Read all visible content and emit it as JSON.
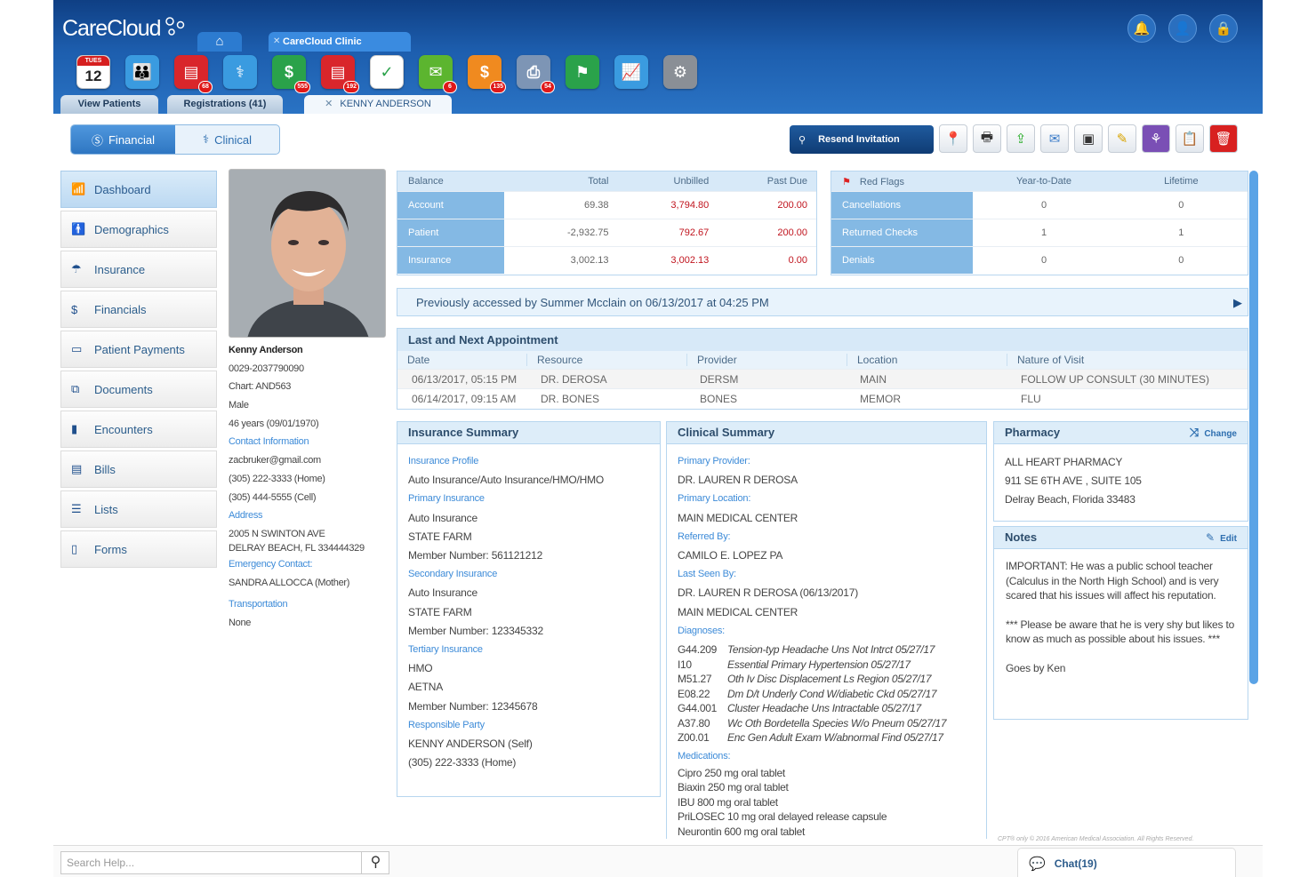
{
  "brand": {
    "logo": "CareCloud"
  },
  "tabs": {
    "clinic": "CareCloud Clinic",
    "view_patients": "View Patients",
    "registrations": "Registrations (41)",
    "patient": "KENNY ANDERSON"
  },
  "calendar": {
    "day": "TUES",
    "date": "12"
  },
  "apps": [
    {
      "name": "calendar-app-icon",
      "color": "#ffffff"
    },
    {
      "name": "patients-app-icon",
      "color": "#3a9be0"
    },
    {
      "name": "records-app-icon",
      "color": "#d9262b",
      "badge": "68"
    },
    {
      "name": "clinical-app-icon",
      "color": "#3a9be0"
    },
    {
      "name": "billing-app-icon",
      "color": "#2aa24a",
      "badge": "555"
    },
    {
      "name": "documents-app-icon",
      "color": "#d9262b",
      "badge": "192"
    },
    {
      "name": "tasks-app-icon",
      "color": "#ffffff"
    },
    {
      "name": "messages-app-icon",
      "color": "#5cb52f",
      "badge": "6"
    },
    {
      "name": "collections-app-icon",
      "color": "#f08a1f",
      "badge": "135"
    },
    {
      "name": "fax-app-icon",
      "color": "#7d95b5",
      "badge": "54"
    },
    {
      "name": "campaign-app-icon",
      "color": "#2aa24a"
    },
    {
      "name": "analytics-app-icon",
      "color": "#3a9be0"
    },
    {
      "name": "settings-app-icon",
      "color": "#8a8f96"
    }
  ],
  "toggle": {
    "financial": "Financial",
    "clinical": "Clinical"
  },
  "resend": "Resend Invitation",
  "nav": [
    "Dashboard",
    "Demographics",
    "Insurance",
    "Financials",
    "Patient Payments",
    "Documents",
    "Encounters",
    "Bills",
    "Lists",
    "Forms"
  ],
  "patient": {
    "name": "Kenny Anderson",
    "id": "0029-2037790090",
    "chart": "Chart: AND563",
    "sex": "Male",
    "age": "46 years (09/01/1970)",
    "contact_h": "Contact Information",
    "email": "zacbruker@gmail.com",
    "home": "(305) 222-3333 (Home)",
    "cell": "(305) 444-5555 (Cell)",
    "address_h": "Address",
    "addr1": "2005 N SWINTON AVE",
    "addr2": "DELRAY BEACH, FL 334444329",
    "emergency_h": "Emergency Contact:",
    "emergency": "SANDRA ALLOCCA (Mother)",
    "transport_h": "Transportation",
    "transport": "None"
  },
  "balance": {
    "headers": [
      "Balance",
      "Total",
      "Unbilled",
      "Past Due"
    ],
    "rows": [
      {
        "label": "Account",
        "total": "69.38",
        "unbilled": "3,794.80",
        "past_due": "200.00"
      },
      {
        "label": "Patient",
        "total": "-2,932.75",
        "unbilled": "792.67",
        "past_due": "200.00"
      },
      {
        "label": "Insurance",
        "total": "3,002.13",
        "unbilled": "3,002.13",
        "past_due": "0.00"
      }
    ]
  },
  "flags": {
    "headers": [
      "Red Flags",
      "Year-to-Date",
      "Lifetime"
    ],
    "rows": [
      {
        "label": "Cancellations",
        "ytd": "0",
        "life": "0"
      },
      {
        "label": "Returned Checks",
        "ytd": "1",
        "life": "1"
      },
      {
        "label": "Denials",
        "ytd": "0",
        "life": "0"
      }
    ]
  },
  "banner": "Previously accessed by Summer Mcclain on 06/13/2017 at 04:25 PM",
  "appt": {
    "title": "Last and Next Appointment",
    "headers": [
      "Date",
      "Resource",
      "Provider",
      "Location",
      "Nature of Visit"
    ],
    "rows": [
      [
        "06/13/2017, 05:15 PM",
        "DR. DEROSA",
        "DERSM",
        "MAIN",
        "FOLLOW UP CONSULT (30 MINUTES)"
      ],
      [
        "06/14/2017, 09:15 AM",
        "DR. BONES",
        "BONES",
        "MEMOR",
        "FLU"
      ]
    ]
  },
  "insurance": {
    "title": "Insurance Summary",
    "lines": [
      [
        "h",
        "Insurance Profile"
      ],
      [
        "t",
        "Auto Insurance/Auto Insurance/HMO/HMO"
      ],
      [
        "h",
        "Primary Insurance"
      ],
      [
        "t",
        "Auto Insurance"
      ],
      [
        "t",
        "STATE FARM"
      ],
      [
        "t",
        "Member Number: 561121212"
      ],
      [
        "h",
        "Secondary Insurance"
      ],
      [
        "t",
        "Auto Insurance"
      ],
      [
        "t",
        "STATE FARM"
      ],
      [
        "t",
        "Member Number: 123345332"
      ],
      [
        "h",
        "Tertiary Insurance"
      ],
      [
        "t",
        "HMO"
      ],
      [
        "t",
        "AETNA"
      ],
      [
        "t",
        "Member Number: 12345678"
      ],
      [
        "h",
        "Responsible Party"
      ],
      [
        "t",
        "KENNY ANDERSON (Self)"
      ],
      [
        "t",
        "(305) 222-3333 (Home)"
      ]
    ]
  },
  "clinical": {
    "title": "Clinical Summary",
    "top": [
      [
        "h",
        "Primary Provider:"
      ],
      [
        "t",
        "DR. LAUREN R DEROSA"
      ],
      [
        "h",
        "Primary Location:"
      ],
      [
        "t",
        "MAIN MEDICAL CENTER"
      ],
      [
        "h",
        "Referred By:"
      ],
      [
        "t",
        "CAMILO E. LOPEZ PA"
      ],
      [
        "h",
        "Last Seen By:"
      ],
      [
        "t",
        "DR. LAUREN R DEROSA (06/13/2017)"
      ],
      [
        "t",
        "MAIN MEDICAL CENTER"
      ],
      [
        "h",
        "Diagnoses:"
      ]
    ],
    "diagnoses": [
      [
        "G44.209",
        "Tension-typ Headache Uns Not Intrct 05/27/17"
      ],
      [
        "I10",
        "Essential Primary Hypertension 05/27/17"
      ],
      [
        "M51.27",
        "Oth Iv Disc Displacement Ls Region 05/27/17"
      ],
      [
        "E08.22",
        "Dm D/t Underly Cond W/diabetic Ckd 05/27/17"
      ],
      [
        "G44.001",
        "Cluster Headache Uns Intractable 05/27/17"
      ],
      [
        "A37.80",
        "Wc Oth Bordetella Species W/o Pneum 05/27/17"
      ],
      [
        "Z00.01",
        "Enc Gen Adult Exam W/abnormal Find 05/27/17"
      ]
    ],
    "med_h": "Medications:",
    "meds": [
      "Cipro 250 mg oral tablet",
      "Biaxin 250 mg oral tablet",
      "IBU 800 mg oral tablet",
      "PriLOSEC 10 mg oral delayed release capsule",
      "Neurontin 600 mg oral tablet"
    ]
  },
  "pharmacy": {
    "title": "Pharmacy",
    "action": "Change",
    "lines": [
      "ALL HEART PHARMACY",
      "911 SE 6TH AVE , SUITE 105",
      "Delray Beach, Florida  33483"
    ]
  },
  "notes": {
    "title": "Notes",
    "action": "Edit",
    "p1": "IMPORTANT: He was a public school teacher (Calculus in the North High School) and is very scared that his issues will affect his reputation.",
    "p2": "*** Please be aware that he is very shy but likes to know as much as possible about his issues. ***",
    "p3": "Goes by Ken"
  },
  "search": {
    "placeholder": "Search Help..."
  },
  "chat": "Chat(19)",
  "copyright": "CPT® only © 2016 American Medical Association. All Rights Reserved."
}
